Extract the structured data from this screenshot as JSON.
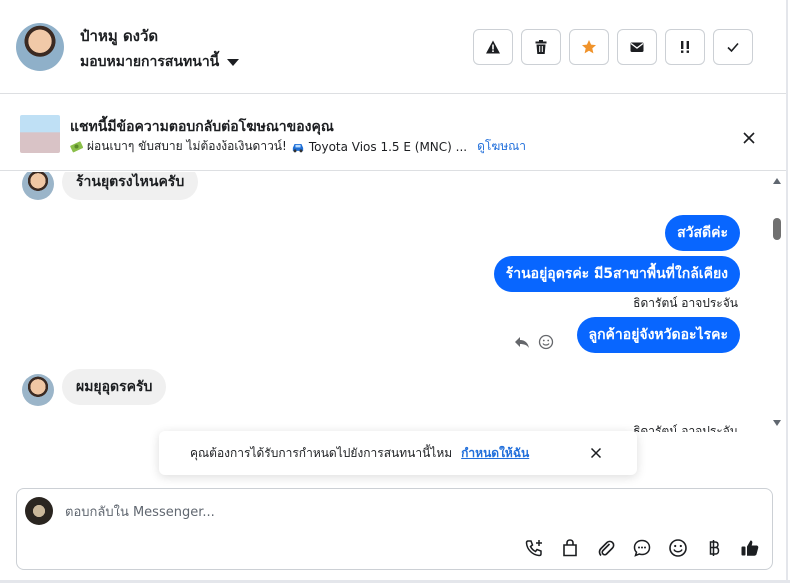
{
  "header": {
    "contact_name": "ป๋าหมู ดงวัด",
    "assign_label": "มอบหมายการสนทนานี้",
    "actions": [
      {
        "name": "warning-icon",
        "label": "Report"
      },
      {
        "name": "trash-icon",
        "label": "Delete"
      },
      {
        "name": "star-icon",
        "label": "Star",
        "color": "#f0932b"
      },
      {
        "name": "envelope-icon",
        "label": "Mark unread"
      },
      {
        "name": "exclamation-icon",
        "label": "Follow up"
      },
      {
        "name": "checkmark-icon",
        "label": "Done"
      }
    ]
  },
  "ad_banner": {
    "title": "แชทนี้มีข้อความตอบกลับต่อโฆษณาของคุณ",
    "subtitle": "ผ่อนเบาๆ ขับสบาย ไม่ต้องง้อเงินดาวน์!",
    "product": "Toyota Vios 1.5 E (MNC) ...",
    "link": "ดูโฆษณา"
  },
  "messages": [
    {
      "direction": "in",
      "text": "ร้านยุตรงไหนครับ"
    },
    {
      "direction": "out",
      "text": "สวัสดีค่ะ"
    },
    {
      "direction": "out",
      "text": "ร้านอยู่อุดรค่ะ มี5สาขาพื้นที่ใกล้เคียง"
    },
    {
      "direction": "meta",
      "text": "ธิดารัตน์ อาจประจัน"
    },
    {
      "direction": "out",
      "text": "ลูกค้าอยู่จังหวัดอะไรคะ"
    },
    {
      "direction": "in",
      "text": "ผมยุอุดรครับ"
    },
    {
      "direction": "meta",
      "text": "ธิดารัตน์ อาจประจัน"
    }
  ],
  "reminder": {
    "text": "คุณต้องการได้รับการกำหนดไปยังการสนทนานี้ไหม",
    "link": "กำหนดให้ฉัน"
  },
  "composer": {
    "placeholder": "ตอบกลับใน Messenger...",
    "tools": [
      "phone-add-icon",
      "shopping-bag-icon",
      "paperclip-icon",
      "chat-bubble-icon",
      "smiley-icon",
      "baht-icon",
      "thumbs-up-icon"
    ]
  },
  "colors": {
    "accent": "#0866ff",
    "link": "#216fdb",
    "star": "#f0932b"
  }
}
